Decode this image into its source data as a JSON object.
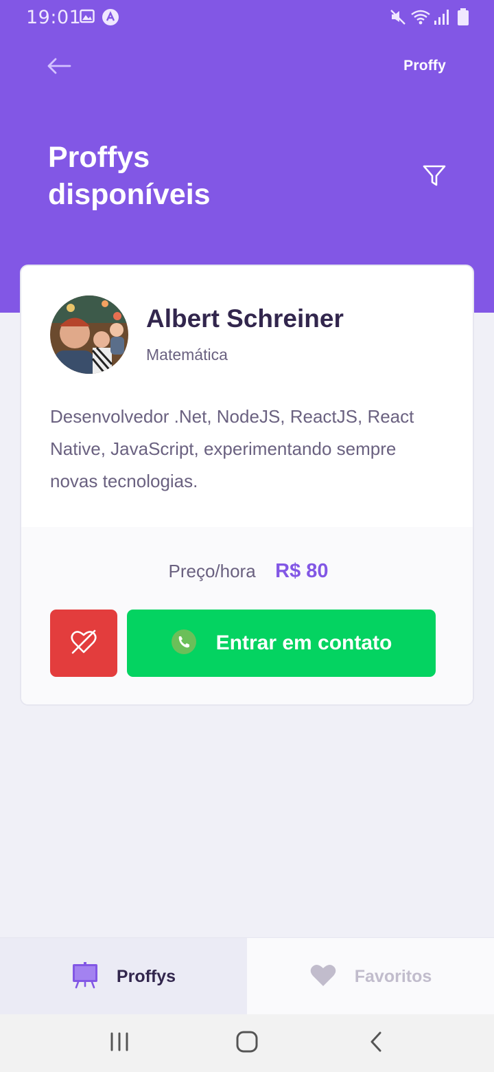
{
  "status_bar": {
    "time": "19:01",
    "left_icons": [
      "gallery-icon",
      "app-notification-icon"
    ],
    "right_icons": [
      "mute-icon",
      "wifi-icon",
      "signal-icon",
      "battery-icon"
    ]
  },
  "header": {
    "back_icon": "arrow-left-icon",
    "brand": "Proffy",
    "title_line1": "Proffys",
    "title_line2": "disponíveis",
    "filter_icon": "filter-icon"
  },
  "teacher_card": {
    "name": "Albert Schreiner",
    "subject": "Matemática",
    "bio": "Desenvolvedor .Net, NodeJS, ReactJS, React Native, JavaScript, experimentando sempre novas tecnologias.",
    "price_label": "Preço/hora",
    "price_value": "R$ 80",
    "unfavorite_icon": "heart-outline-off-icon",
    "contact_label": "Entrar em contato",
    "contact_icon": "whatsapp-icon"
  },
  "tabs": [
    {
      "label": "Proffys",
      "icon": "easel-icon",
      "active": true
    },
    {
      "label": "Favoritos",
      "icon": "heart-icon",
      "active": false
    }
  ],
  "colors": {
    "primary": "#8257E5",
    "secondary": "#04D361",
    "danger": "#E33D3D",
    "title_text": "#32264D",
    "body_text": "#6A6180",
    "background": "#F0F0F7"
  }
}
